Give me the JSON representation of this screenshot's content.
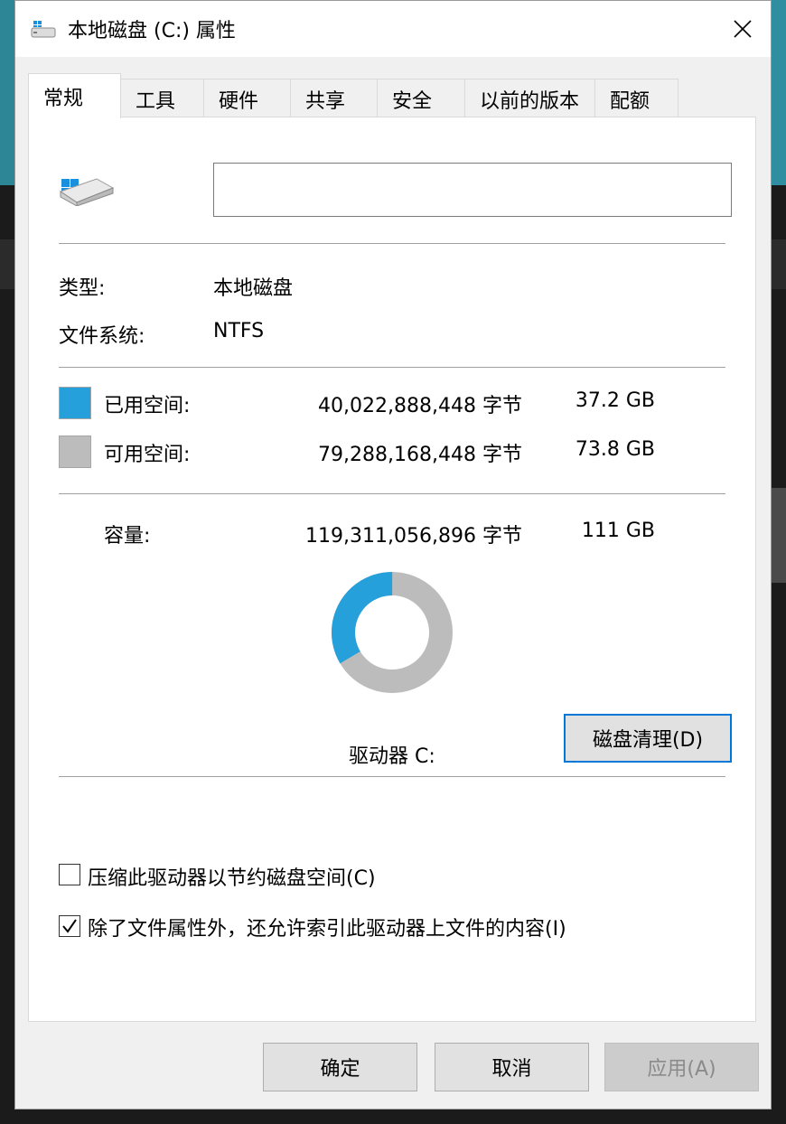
{
  "window": {
    "title": "本地磁盘 (C:) 属性",
    "close_label": "✕"
  },
  "tabs": [
    {
      "label": "常规",
      "active": true
    },
    {
      "label": "工具"
    },
    {
      "label": "硬件"
    },
    {
      "label": "共享"
    },
    {
      "label": "安全"
    },
    {
      "label": "以前的版本"
    },
    {
      "label": "配额"
    }
  ],
  "general": {
    "volume_label_value": "",
    "type_label": "类型:",
    "type_value": "本地磁盘",
    "fs_label": "文件系统:",
    "fs_value": "NTFS",
    "used": {
      "label": "已用空间:",
      "bytes": "40,022,888,448 字节",
      "size": "37.2 GB",
      "color": "#26a0da"
    },
    "free": {
      "label": "可用空间:",
      "bytes": "79,288,168,448 字节",
      "size": "73.8 GB",
      "color": "#bcbcbc"
    },
    "capacity": {
      "label": "容量:",
      "bytes": "119,311,056,896 字节",
      "size": "111 GB"
    },
    "used_fraction": 0.3354,
    "drive_label": "驱动器 C:",
    "cleanup_button": "磁盘清理(D)",
    "compress_checkbox": {
      "label": "压缩此驱动器以节约磁盘空间(C)",
      "checked": false
    },
    "index_checkbox": {
      "label": "除了文件属性外，还允许索引此驱动器上文件的内容(I)",
      "checked": true
    }
  },
  "footer": {
    "ok": "确定",
    "cancel": "取消",
    "apply": "应用(A)"
  }
}
